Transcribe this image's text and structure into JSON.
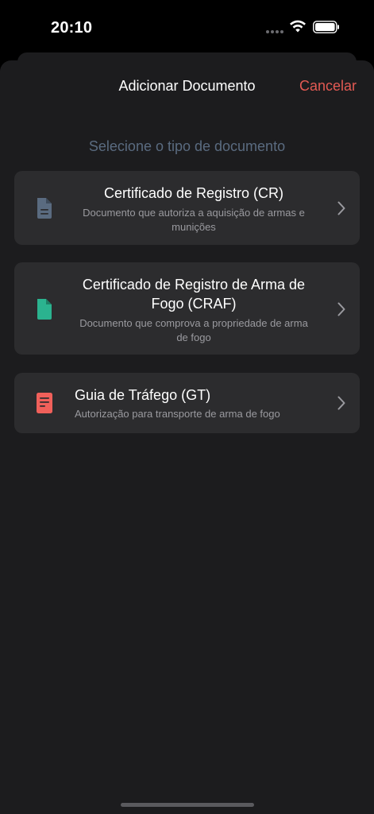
{
  "status_bar": {
    "time": "20:10"
  },
  "header": {
    "title": "Adicionar Documento",
    "cancel_label": "Cancelar"
  },
  "section": {
    "subtitle": "Selecione o tipo de documento"
  },
  "documents": [
    {
      "title": "Certificado de Registro (CR)",
      "description": "Documento que autoriza a aquisição de armas e munições",
      "icon": "document-text-icon",
      "color": "#5a6b80"
    },
    {
      "title": "Certificado de Registro de Arma de Fogo (CRAF)",
      "description": "Documento que comprova a propriedade de arma de fogo",
      "icon": "document-icon",
      "color": "#2bb38f"
    },
    {
      "title": "Guia de Tráfego (GT)",
      "description": "Autorização para transporte de arma de fogo",
      "icon": "document-lines-icon",
      "color": "#f0605a"
    }
  ],
  "colors": {
    "accent": "#e35a53",
    "sheet_background": "#1c1c1e",
    "card_background": "#2c2c2e",
    "subtitle": "#5a6b80"
  }
}
